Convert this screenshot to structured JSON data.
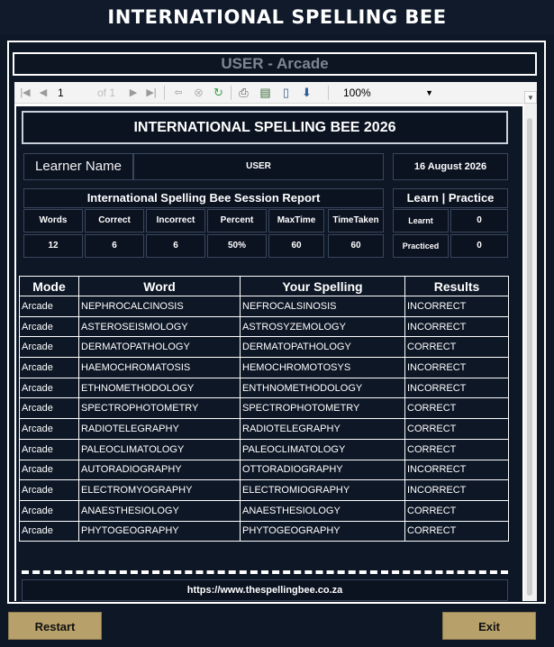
{
  "app": {
    "title": "INTERNATIONAL SPELLING BEE"
  },
  "user_bar": {
    "text": "USER  - Arcade"
  },
  "toolbar": {
    "page": "1",
    "of": "of 1",
    "zoom": "100%"
  },
  "report": {
    "title": "INTERNATIONAL SPELLING BEE 2026",
    "learner_label": "Learner Name",
    "learner_name": "USER",
    "date": "16 August 2026",
    "session_title": "International Spelling Bee Session Report",
    "stats_headers": [
      "Words",
      "Correct",
      "Incorrect",
      "Percent",
      "MaxTime",
      "TimeTaken"
    ],
    "stats_values": [
      "12",
      "6",
      "6",
      "50%",
      "60",
      "60"
    ],
    "learn_title": "Learn | Practice",
    "learnt_label": "Learnt",
    "learnt_value": "0",
    "practiced_label": "Practiced",
    "practiced_value": "0",
    "table_headers": [
      "Mode",
      "Word",
      "Your Spelling",
      "Results"
    ],
    "rows": [
      [
        "Arcade",
        "NEPHROCALCINOSIS",
        "NEFROCALSINOSIS",
        "INCORRECT"
      ],
      [
        "Arcade",
        "ASTEROSEISMOLOGY",
        "ASTROSYZEMOLOGY",
        "INCORRECT"
      ],
      [
        "Arcade",
        "DERMATOPATHOLOGY",
        "DERMATOPATHOLOGY",
        "CORRECT"
      ],
      [
        "Arcade",
        "HAEMOCHROMATOSIS",
        "HEMOCHROMOTOSYS",
        "INCORRECT"
      ],
      [
        "Arcade",
        "ETHNOMETHODOLOGY",
        "ENTHNOMETHODOLOGY",
        "INCORRECT"
      ],
      [
        "Arcade",
        "SPECTROPHOTOMETRY",
        "SPECTROPHOTOMETRY",
        "CORRECT"
      ],
      [
        "Arcade",
        "RADIOTELEGRAPHY",
        "RADIOTELEGRAPHY",
        "CORRECT"
      ],
      [
        "Arcade",
        "PALEOCLIMATOLOGY",
        "PALEOCLIMATOLOGY",
        "CORRECT"
      ],
      [
        "Arcade",
        "AUTORADIOGRAPHY",
        "OTTORADIOGRAPHY",
        "INCORRECT"
      ],
      [
        "Arcade",
        "ELECTROMYOGRAPHY",
        "ELECTROMIOGRAPHY",
        "INCORRECT"
      ],
      [
        "Arcade",
        "ANAESTHESIOLOGY",
        "ANAESTHESIOLOGY",
        "CORRECT"
      ],
      [
        "Arcade",
        "PHYTOGEOGRAPHY",
        "PHYTOGEOGRAPHY",
        "CORRECT"
      ]
    ],
    "footer_url": "https://www.thespellingbee.co.za"
  },
  "buttons": {
    "restart": "Restart",
    "exit": "Exit"
  },
  "colors": {
    "background": "#0e1726",
    "button": "#b8a06a",
    "frame": "#ffffff"
  },
  "icons": [
    "first-page-icon",
    "prev-page-icon",
    "next-page-icon",
    "last-page-icon",
    "back-icon",
    "stop-icon",
    "refresh-icon",
    "print-icon",
    "page-setup-icon",
    "print-layout-icon",
    "export-icon"
  ]
}
